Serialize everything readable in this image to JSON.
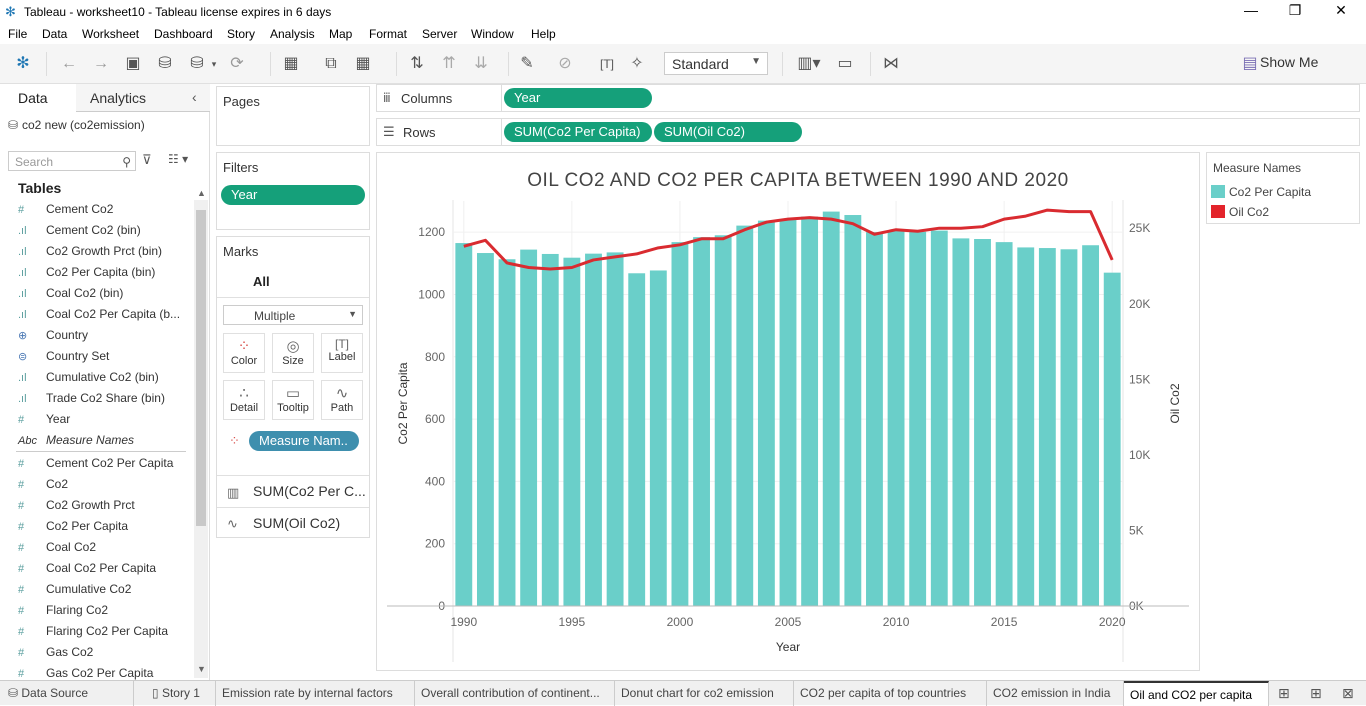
{
  "window": {
    "title": "Tableau - worksheet10 - Tableau license expires in 6 days",
    "minimize": "—",
    "restore": "❐",
    "close": "✕"
  },
  "menu": [
    "File",
    "Data",
    "Worksheet",
    "Dashboard",
    "Story",
    "Analysis",
    "Map",
    "Format",
    "Server",
    "Window",
    "Help"
  ],
  "toolbar": {
    "view_mode": "Standard",
    "show_me": "Show Me"
  },
  "left": {
    "tab_data": "Data",
    "tab_analytics": "Analytics",
    "datasource": "co2 new (co2emission)",
    "search_placeholder": "Search",
    "tables_heading": "Tables",
    "fields": [
      {
        "icon": "dim-icon",
        "name": "Cement Co2"
      },
      {
        "icon": "bin-icon",
        "name": "Cement Co2 (bin)"
      },
      {
        "icon": "bin-icon",
        "name": "Co2 Growth Prct (bin)"
      },
      {
        "icon": "bin-icon",
        "name": "Co2 Per Capita (bin)"
      },
      {
        "icon": "bin-icon",
        "name": "Coal Co2 (bin)"
      },
      {
        "icon": "bin-icon",
        "name": "Coal Co2 Per Capita (b..."
      },
      {
        "icon": "globe-icon",
        "name": "Country"
      },
      {
        "icon": "set-icon",
        "name": "Country Set"
      },
      {
        "icon": "bin-icon",
        "name": "Cumulative Co2 (bin)"
      },
      {
        "icon": "bin-icon",
        "name": "Trade Co2 Share (bin)"
      },
      {
        "icon": "dim-icon",
        "name": "Year"
      },
      {
        "icon": "abc-icon",
        "name": "Measure Names"
      },
      {
        "icon": "measure-icon",
        "name": "Cement Co2 Per Capita"
      },
      {
        "icon": "measure-icon",
        "name": "Co2"
      },
      {
        "icon": "measure-icon",
        "name": "Co2 Growth Prct"
      },
      {
        "icon": "measure-icon",
        "name": "Co2 Per Capita"
      },
      {
        "icon": "measure-icon",
        "name": "Coal Co2"
      },
      {
        "icon": "measure-icon",
        "name": "Coal Co2 Per Capita"
      },
      {
        "icon": "measure-icon",
        "name": "Cumulative Co2"
      },
      {
        "icon": "measure-icon",
        "name": "Flaring Co2"
      },
      {
        "icon": "measure-icon",
        "name": "Flaring Co2 Per Capita"
      },
      {
        "icon": "measure-icon",
        "name": "Gas Co2"
      },
      {
        "icon": "measure-icon",
        "name": "Gas Co2 Per Capita"
      }
    ]
  },
  "pages": {
    "title": "Pages"
  },
  "filters": {
    "title": "Filters",
    "pill": "Year"
  },
  "marks": {
    "title": "Marks",
    "all": "All",
    "type": "Multiple",
    "buttons": [
      "Color",
      "Size",
      "Label",
      "Detail",
      "Tooltip",
      "Path"
    ],
    "color_pill": "Measure Nam..",
    "layers": [
      "SUM(Co2 Per C...",
      "SUM(Oil Co2)"
    ]
  },
  "shelves": {
    "columns_label": "Columns",
    "columns_pill": "Year",
    "rows_label": "Rows",
    "rows_pills": [
      "SUM(Co2 Per Capita)",
      "SUM(Oil Co2)"
    ]
  },
  "legend": {
    "title": "Measure Names",
    "items": [
      {
        "name": "Co2 Per Capita",
        "color": "#6acfc9"
      },
      {
        "name": "Oil Co2",
        "color": "#e3242b"
      }
    ]
  },
  "colors": {
    "bar": "#6acfc9",
    "line": "#d92b30",
    "pill_green": "#15a07a",
    "pill_blue": "#3e8fae"
  },
  "chart_data": {
    "type": "bar",
    "title": "OIL CO2 AND CO2 PER CAPITA BETWEEN 1990 AND 2020",
    "xlabel": "Year",
    "ylabel": "Co2 Per Capita",
    "y2label": "Oil Co2",
    "x": [
      1990,
      1991,
      1992,
      1993,
      1994,
      1995,
      1996,
      1997,
      1998,
      1999,
      2000,
      2001,
      2002,
      2003,
      2004,
      2005,
      2006,
      2007,
      2008,
      2009,
      2010,
      2011,
      2012,
      2013,
      2014,
      2015,
      2016,
      2017,
      2018,
      2019,
      2020
    ],
    "x_ticks": [
      1990,
      1995,
      2000,
      2005,
      2010,
      2015,
      2020
    ],
    "ylim": [
      0,
      1300
    ],
    "y_ticks": [
      0,
      200,
      400,
      600,
      800,
      1000,
      1200
    ],
    "y2lim": [
      0,
      26800
    ],
    "y2_ticks": [
      0,
      5000,
      10000,
      15000,
      20000,
      25000
    ],
    "y2_tick_labels": [
      "0K",
      "5K",
      "10K",
      "15K",
      "20K",
      "25K"
    ],
    "grid": true,
    "legend": "right",
    "series": [
      {
        "name": "Co2 Per Capita",
        "type": "bar",
        "values": [
          1165,
          1133,
          1113,
          1144,
          1130,
          1118,
          1131,
          1135,
          1068,
          1077,
          1168,
          1184,
          1190,
          1221,
          1237,
          1241,
          1250,
          1266,
          1255,
          1200,
          1206,
          1201,
          1205,
          1180,
          1178,
          1168,
          1151,
          1149,
          1145,
          1158,
          1070
        ]
      },
      {
        "name": "Oil Co2",
        "type": "line",
        "axis": "right",
        "values": [
          23800,
          24200,
          22700,
          22400,
          22300,
          22400,
          22900,
          23100,
          23300,
          23700,
          23900,
          24300,
          24300,
          24900,
          25400,
          25600,
          25700,
          25600,
          25300,
          24600,
          24900,
          24800,
          25000,
          25000,
          25100,
          25600,
          25800,
          26200,
          26100,
          26100,
          22900
        ]
      }
    ]
  },
  "bottom_tabs": [
    "Data Source",
    "Story 1",
    "Emission rate by internal factors",
    "Overall contribution of continent...",
    "Donut chart for co2 emission",
    "CO2 per capita of top countries",
    "CO2 emission in India",
    "Oil and CO2 per capita"
  ],
  "active_tab": "Oil and CO2 per capita"
}
